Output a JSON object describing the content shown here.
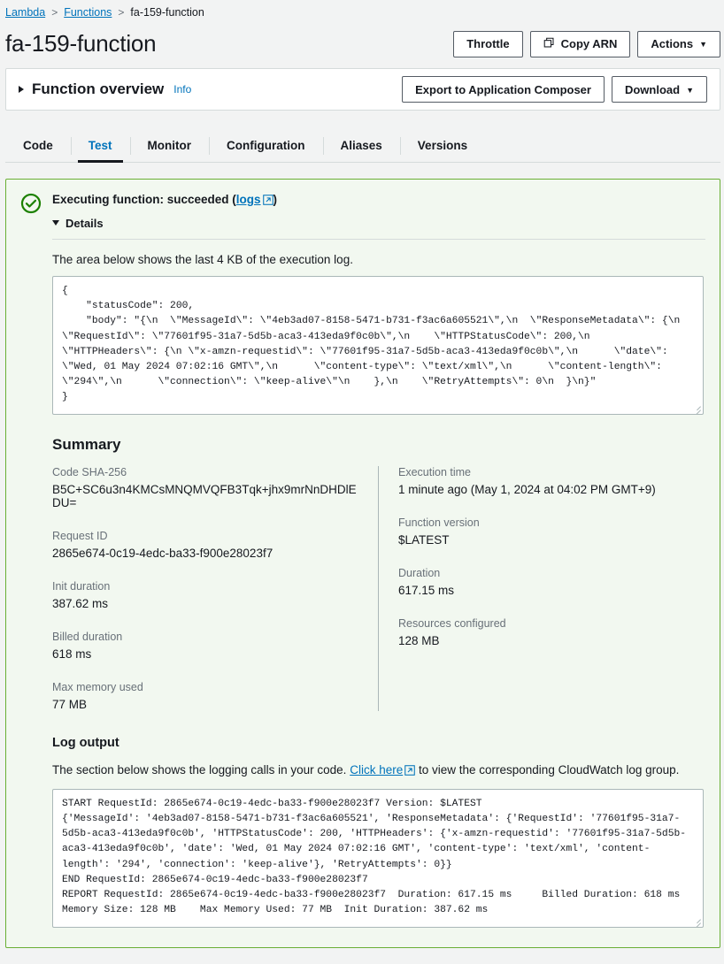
{
  "breadcrumb": {
    "items": [
      {
        "label": "Lambda",
        "link": true
      },
      {
        "label": "Functions",
        "link": true
      },
      {
        "label": "fa-159-function",
        "link": false
      }
    ],
    "separator": ">"
  },
  "header": {
    "title": "fa-159-function",
    "buttons": {
      "throttle": "Throttle",
      "copy_arn": "Copy ARN",
      "actions": "Actions",
      "caret": "▼"
    },
    "icons": {
      "copy": "copy-icon",
      "chevron": "chevron-down-icon"
    }
  },
  "function_overview": {
    "title": "Function overview",
    "info_label": "Info",
    "collapsed": true,
    "buttons": {
      "export": "Export to Application Composer",
      "download": "Download",
      "caret": "▼"
    }
  },
  "tabs": {
    "active": "Test",
    "items": [
      {
        "label": "Code"
      },
      {
        "label": "Test"
      },
      {
        "label": "Monitor"
      },
      {
        "label": "Configuration"
      },
      {
        "label": "Aliases"
      },
      {
        "label": "Versions"
      }
    ]
  },
  "result": {
    "status_icon": "success-check-icon",
    "status_color": "#1d8102",
    "panel_bg": "#f2f8f0",
    "panel_border": "#6aaf35",
    "title_prefix": "Executing function: succeeded (",
    "logs_link": "logs",
    "title_suffix": ")",
    "external_icon": "external-link-icon",
    "details_label": "Details",
    "details_expanded": true,
    "exec_log_note": "The area below shows the last 4 KB of the execution log.",
    "execution_log": "{\n    \"statusCode\": 200,\n    \"body\": \"{\\n  \\\"MessageId\\\": \\\"4eb3ad07-8158-5471-b731-f3ac6a605521\\\",\\n  \\\"ResponseMetadata\\\": {\\n \\\"RequestId\\\": \\\"77601f95-31a7-5d5b-aca3-413eda9f0c0b\\\",\\n    \\\"HTTPStatusCode\\\": 200,\\n    \\\"HTTPHeaders\\\": {\\n \\\"x-amzn-requestid\\\": \\\"77601f95-31a7-5d5b-aca3-413eda9f0c0b\\\",\\n      \\\"date\\\": \\\"Wed, 01 May 2024 07:02:16 GMT\\\",\\n      \\\"content-type\\\": \\\"text/xml\\\",\\n      \\\"content-length\\\": \\\"294\\\",\\n      \\\"connection\\\": \\\"keep-alive\\\"\\n    },\\n    \\\"RetryAttempts\\\": 0\\n  }\\n}\"\n}"
  },
  "summary": {
    "title": "Summary",
    "left": [
      {
        "label": "Code SHA-256",
        "value": "B5C+SC6u3n4KMCsMNQMVQFB3Tqk+jhx9mrNnDHDlEDU="
      },
      {
        "label": "Request ID",
        "value": "2865e674-0c19-4edc-ba33-f900e28023f7"
      },
      {
        "label": "Init duration",
        "value": "387.62 ms"
      },
      {
        "label": "Billed duration",
        "value": "618 ms"
      },
      {
        "label": "Max memory used",
        "value": "77 MB"
      }
    ],
    "right": [
      {
        "label": "Execution time",
        "value": "1 minute ago (May 1, 2024 at 04:02 PM GMT+9)"
      },
      {
        "label": "Function version",
        "value": "$LATEST"
      },
      {
        "label": "Duration",
        "value": "617.15 ms"
      },
      {
        "label": "Resources configured",
        "value": "128 MB"
      }
    ]
  },
  "log_output": {
    "title": "Log output",
    "note_prefix": "The section below shows the logging calls in your code. ",
    "note_link": "Click here",
    "note_suffix": " to view the corresponding CloudWatch log group.",
    "external_icon": "external-link-icon",
    "text": "START RequestId: 2865e674-0c19-4edc-ba33-f900e28023f7 Version: $LATEST\n{'MessageId': '4eb3ad07-8158-5471-b731-f3ac6a605521', 'ResponseMetadata': {'RequestId': '77601f95-31a7-5d5b-aca3-413eda9f0c0b', 'HTTPStatusCode': 200, 'HTTPHeaders': {'x-amzn-requestid': '77601f95-31a7-5d5b-aca3-413eda9f0c0b', 'date': 'Wed, 01 May 2024 07:02:16 GMT', 'content-type': 'text/xml', 'content-length': '294', 'connection': 'keep-alive'}, 'RetryAttempts': 0}}\nEND RequestId: 2865e674-0c19-4edc-ba33-f900e28023f7\nREPORT RequestId: 2865e674-0c19-4edc-ba33-f900e28023f7  Duration: 617.15 ms     Billed Duration: 618 ms Memory Size: 128 MB    Max Memory Used: 77 MB  Init Duration: 387.62 ms"
  },
  "colors": {
    "link": "#0073bb",
    "page_bg": "#f2f3f3",
    "text": "#16191f",
    "muted": "#687078",
    "border": "#d5dbdb",
    "success": "#1d8102"
  }
}
